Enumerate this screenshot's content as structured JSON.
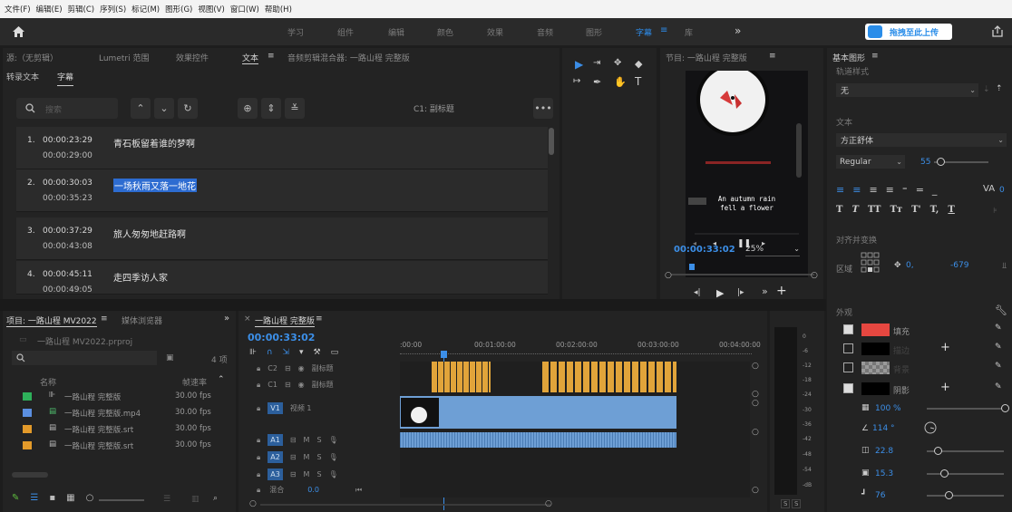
{
  "menu": [
    "文件(F)",
    "编辑(E)",
    "剪辑(C)",
    "序列(S)",
    "标记(M)",
    "图形(G)",
    "视图(V)",
    "窗口(W)",
    "帮助(H)"
  ],
  "workspaces": [
    "学习",
    "组件",
    "编辑",
    "颜色",
    "效果",
    "音频",
    "图形",
    "字幕",
    "库"
  ],
  "workspace_active": "字幕",
  "workspace_menu_icon": "≡",
  "more_icon": "»",
  "upload_button": "拖拽至此上传",
  "source_tabs": {
    "source": "源:（无剪辑）",
    "lumetri": "Lumetri 范围",
    "effects": "效果控件",
    "text": "文本",
    "text_menu": "≡",
    "mixer": "音频剪辑混合器: 一路山程 完整版"
  },
  "text_subtabs": {
    "transcript": "转录文本",
    "captions": "字幕"
  },
  "search_placeholder": "搜索",
  "track_label": "C1: 副标题",
  "captions": [
    {
      "n": "1.",
      "in": "00:00:23:29",
      "out": "00:00:29:00",
      "text": "青石板留着谁的梦啊"
    },
    {
      "n": "2.",
      "in": "00:00:30:03",
      "out": "00:00:35:23",
      "text": "一场秋雨又落一地花"
    },
    {
      "n": "3.",
      "in": "00:00:37:29",
      "out": "00:00:43:08",
      "text": "旅人匆匆地赶路啊"
    },
    {
      "n": "4.",
      "in": "00:00:45:11",
      "out": "00:00:49:05",
      "text": "走四季访人家"
    }
  ],
  "program": {
    "title": "节目: 一路山程 完整版",
    "menu": "≡",
    "timecode": "00:00:33:02",
    "zoom": "25%",
    "subtitle_en": "An autumn rain fell a flower",
    "subtitle_en_line1": "An autumn rain",
    "subtitle_en_line2": "fell a flower"
  },
  "project": {
    "title": "项目: 一路山程 MV2022",
    "menu": "≡",
    "media_tab": "媒体浏览器",
    "more": "»",
    "file": "一路山程 MV2022.prproj",
    "count": "4 项",
    "col_name": "名称",
    "col_fps": "帧速率",
    "items": [
      {
        "name": "一路山程 完整版",
        "fps": "30.00 fps",
        "color": "#2eb05a"
      },
      {
        "name": "一路山程 完整版.mp4",
        "fps": "30.00 fps",
        "color": "#5b8fe0"
      },
      {
        "name": "一路山程 完整版.srt",
        "fps": "30.00 fps",
        "color": "#e39a2a"
      },
      {
        "name": "一路山程 完整版.srt",
        "fps": "30.00 fps",
        "color": "#e39a2a"
      }
    ]
  },
  "timeline": {
    "close": "×",
    "title": "一路山程 完整版",
    "menu": "≡",
    "timecode": "00:00:33:02",
    "ruler": [
      ":00:00",
      "00:01:00:00",
      "00:02:00:00",
      "00:03:00:00",
      "00:04:00:00"
    ],
    "tracks": {
      "c2": "C2",
      "c1": "C1",
      "c_label": "副标题",
      "v1": "V1",
      "v1_name": "视频 1",
      "a1": "A1",
      "a2": "A2",
      "a3": "A3",
      "mix": "混合",
      "mix_val": "0.0",
      "m": "M",
      "s": "S"
    }
  },
  "meter": {
    "ticks": [
      "0",
      "-6",
      "-12",
      "-18",
      "-24",
      "-30",
      "-36",
      "-42",
      "-48",
      "-54",
      "-dB"
    ],
    "solo": "S"
  },
  "essential": {
    "title": "基本图形",
    "menu": "≡",
    "track_style": "轨道样式",
    "style_value": "无",
    "text_header": "文本",
    "font": "方正舒体",
    "weight": "Regular",
    "size": "55",
    "kerning": "0",
    "align_header": "对齐并变换",
    "region": "区域",
    "pos_x": "0,",
    "pos_y": "-679",
    "appearance": "外观",
    "fill": "填充",
    "stroke": "描边",
    "bg": "背景",
    "shadow": "阴影",
    "fill_color": "#e64740",
    "opacity": "100 %",
    "angle": "114 °",
    "distance": "22.8",
    "size2": "15.3",
    "blur": "76"
  }
}
